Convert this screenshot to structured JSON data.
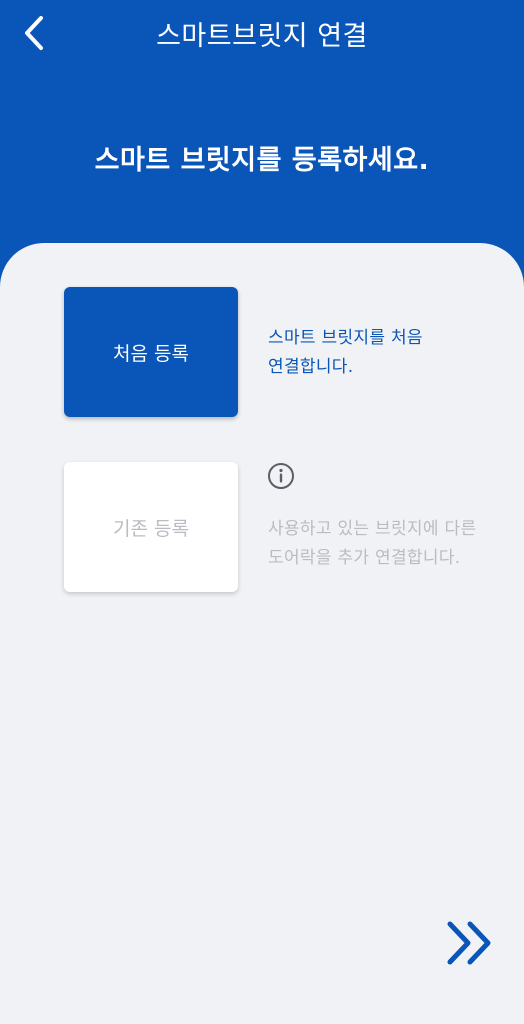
{
  "header": {
    "title": "스마트브릿지 연결",
    "back_icon": "chevron-left-icon"
  },
  "headline": "스마트 브릿지를 등록하세요.",
  "options": {
    "new": {
      "label": "처음 등록",
      "description_line1": "스마트 브릿지를 처음",
      "description_line2": "연결합니다."
    },
    "existing": {
      "label": "기존 등록",
      "info_icon": "info-circle-icon",
      "description_line1": "사용하고 있는 브릿지에 다른",
      "description_line2": "도어락을 추가 연결합니다."
    }
  },
  "footer": {
    "next_icon": "double-chevron-right-icon"
  },
  "colors": {
    "primary": "#0a56b8",
    "panel_background": "#f0f2f6",
    "disabled_text": "#b9bcc2"
  }
}
